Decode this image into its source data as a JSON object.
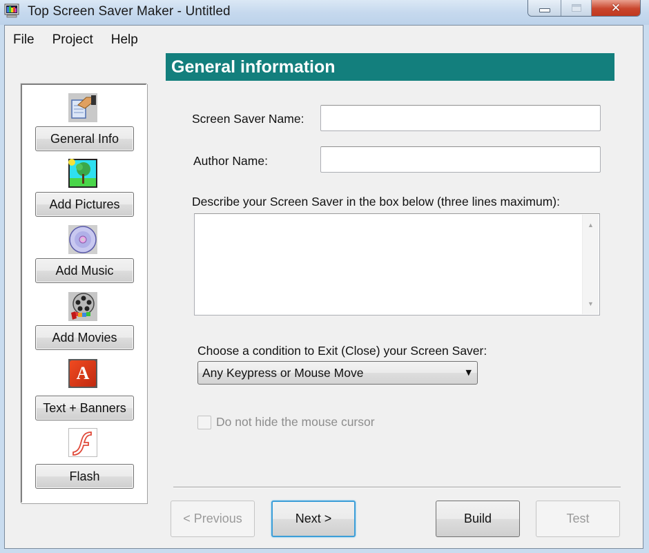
{
  "window": {
    "title": "Top Screen Saver Maker - Untitled",
    "controls": {
      "minimize": "minimize",
      "maximize": "maximize",
      "close": "✕"
    }
  },
  "menu": {
    "items": [
      {
        "label": "File"
      },
      {
        "label": "Project"
      },
      {
        "label": "Help"
      }
    ]
  },
  "sidebar": {
    "items": [
      {
        "label": "General Info",
        "icon": "document-hand-icon"
      },
      {
        "label": "Add Pictures",
        "icon": "tree-picture-icon"
      },
      {
        "label": "Add Music",
        "icon": "cd-disc-icon"
      },
      {
        "label": "Add Movies",
        "icon": "film-reel-icon"
      },
      {
        "label": "Text + Banners",
        "icon": "letter-a-icon"
      },
      {
        "label": "Flash",
        "icon": "flash-icon"
      }
    ],
    "letter_icon_glyph": "A",
    "flash_icon_glyph": "ƒ"
  },
  "section": {
    "title": "General information",
    "header_color": "#137f7d"
  },
  "form": {
    "screen_saver_name": {
      "label": "Screen Saver Name:",
      "value": ""
    },
    "author_name": {
      "label": "Author Name:",
      "value": ""
    },
    "description": {
      "label": "Describe your Screen Saver in the box below (three lines maximum):",
      "value": ""
    },
    "exit_condition": {
      "label": "Choose a condition to Exit (Close) your Screen Saver:",
      "selected": "Any Keypress or Mouse Move"
    },
    "hide_cursor": {
      "label": "Do not hide the mouse cursor",
      "checked": false,
      "enabled": false
    }
  },
  "footer": {
    "previous": {
      "label": "< Previous",
      "enabled": false
    },
    "next": {
      "label": "Next >",
      "enabled": true
    },
    "build": {
      "label": "Build",
      "enabled": true
    },
    "test": {
      "label": "Test",
      "enabled": false
    }
  }
}
